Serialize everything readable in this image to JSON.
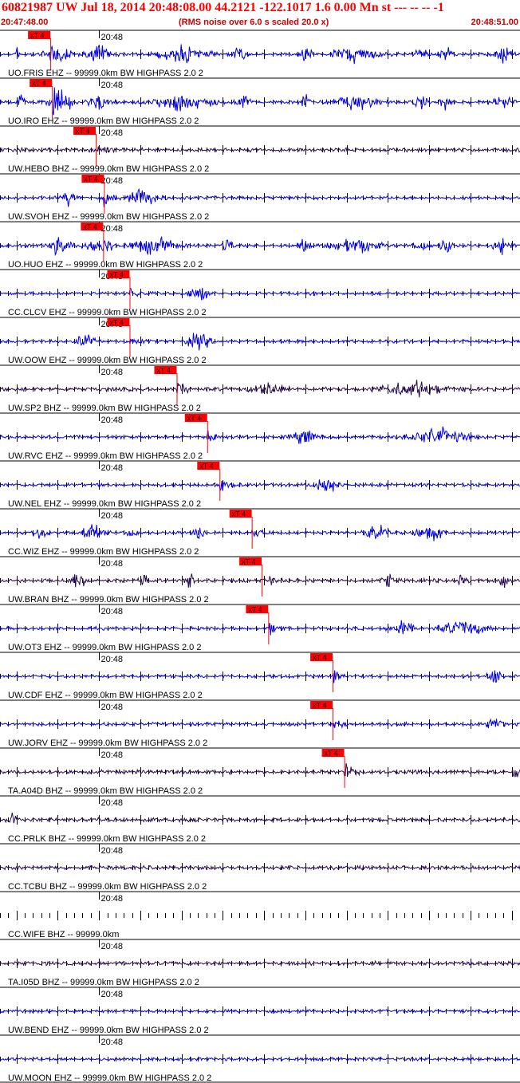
{
  "header": {
    "title": "60821987 UW Jul 18, 2014 20:48:08.00   44.2121 -122.1017  1.6 0.00 Mn st --- -- --  -1",
    "start_time": "20:47:48.00",
    "subtitle": "(RMS noise over 6.0 s scaled 20.0 x)",
    "end_time": "20:48:51.00"
  },
  "colors": {
    "title": "#ff0000",
    "trace_blue": "#0000ee",
    "trace_dark": "#2a0a55",
    "pick": "#ff0000",
    "axis": "#000000"
  },
  "chart_data": {
    "type": "line",
    "title": "60821987 UW Jul 18, 2014 20:48:08.00   44.2121 -122.1017  1.6 0.00 Mn st --- -- --  -1",
    "x_range": [
      "20:47:48.00",
      "20:48:51.00"
    ],
    "x_range_seconds": [
      0,
      63
    ],
    "minute_mark_label": "20:48",
    "minute_mark_seconds": 12,
    "pick_label": "xT 4",
    "traces": [
      {
        "label": "UO.FRIS EHZ -- 99999.0km BW  HIGHPASS  2.0  2",
        "color": "blue",
        "pick_s": 6.1,
        "bursts": [
          [
            2.2,
            0.4
          ],
          [
            6.8,
            1.5
          ],
          [
            12,
            1.3
          ],
          [
            22,
            2.5
          ],
          [
            29,
            0.6
          ],
          [
            37,
            0.6
          ],
          [
            43,
            2.5
          ],
          [
            51,
            0.6
          ],
          [
            54,
            0.7
          ],
          [
            61,
            1.0
          ]
        ]
      },
      {
        "label": "UO.IRO EHZ -- 99999.0km BW  HIGHPASS  2.0  2",
        "color": "blue",
        "pick_s": 6.3,
        "bursts": [
          [
            2.5,
            0.5
          ],
          [
            7.3,
            1.5
          ],
          [
            12,
            1.3
          ],
          [
            22,
            3.2
          ],
          [
            29.5,
            0.8
          ],
          [
            37,
            0.6
          ],
          [
            43,
            2.5
          ],
          [
            51,
            0.6
          ],
          [
            54,
            0.7
          ],
          [
            61,
            1.0
          ]
        ]
      },
      {
        "label": "UW.HEBO BHZ -- 99999.0km BW  HIGHPASS  2.0  2",
        "color": "dark",
        "pick_s": 11.6,
        "bursts": []
      },
      {
        "label": "UW.SVOH EHZ -- 99999.0km BW  HIGHPASS  2.0  2",
        "color": "blue",
        "pick_s": 12.6,
        "bursts": [
          [
            8.5,
            0.8
          ],
          [
            17.5,
            1.8
          ]
        ]
      },
      {
        "label": "UO.HUO EHZ -- 99999.0km BW  HIGHPASS  2.0  2",
        "color": "blue",
        "pick_s": 12.5,
        "bursts": [
          [
            7.2,
            1.3
          ],
          [
            11.8,
            1.3
          ],
          [
            18.5,
            2.5
          ],
          [
            27.5,
            0.6
          ],
          [
            37,
            0.6
          ],
          [
            43,
            2.5
          ],
          [
            51,
            0.6
          ],
          [
            54,
            0.7
          ],
          [
            61,
            1.0
          ]
        ]
      },
      {
        "label": "CC.CLCV EHZ -- 99999.0km BW  HIGHPASS  2.0  2",
        "color": "blue",
        "pick_s": 15.7,
        "bursts": [
          [
            24,
            1.0
          ]
        ]
      },
      {
        "label": "UW.OOW EHZ -- 99999.0km BW  HIGHPASS  2.0  2",
        "color": "blue",
        "pick_s": 15.7,
        "bursts": [
          [
            10.5,
            1.0
          ],
          [
            24.1,
            1.2
          ]
        ]
      },
      {
        "label": "UW.SP2 BHZ -- 99999.0km BW  HIGHPASS  2.0  2",
        "color": "dark",
        "pick_s": 21.4,
        "bursts": [
          [
            32.5,
            1.6
          ],
          [
            50,
            3.5
          ]
        ]
      },
      {
        "label": "UW.RVC EHZ -- 99999.0km BW  HIGHPASS  2.0  2",
        "color": "blue",
        "pick_s": 25.1,
        "bursts": [
          [
            37,
            1.2
          ],
          [
            53,
            3.0
          ]
        ]
      },
      {
        "label": "UW.NEL EHZ -- 99999.0km BW  HIGHPASS  2.0  2",
        "color": "blue",
        "pick_s": 26.6,
        "bursts": [
          [
            39.5,
            1.3
          ]
        ]
      },
      {
        "label": "CC.WIZ EHZ -- 99999.0km BW  HIGHPASS  2.0  2",
        "color": "blue",
        "pick_s": 30.5,
        "bursts": [
          [
            5,
            0.8
          ],
          [
            11,
            1.2
          ],
          [
            16,
            0.5
          ],
          [
            24,
            0.5
          ],
          [
            45.5,
            1.2
          ],
          [
            52,
            1.5
          ]
        ]
      },
      {
        "label": "UW.BRAN BHZ -- 99999.0km BW  HIGHPASS  2.0  2",
        "color": "dark",
        "pick_s": 31.7,
        "bursts": [
          [
            9.5,
            1.0
          ],
          [
            17.5,
            0.4
          ],
          [
            23,
            0.4
          ],
          [
            47,
            0.5
          ],
          [
            56,
            0.5
          ],
          [
            61,
            0.4
          ]
        ]
      },
      {
        "label": "UW.OT3 EHZ -- 99999.0km BW  HIGHPASS  2.0  2",
        "color": "blue",
        "pick_s": 32.5,
        "bursts": [
          [
            48.5,
            1.3
          ],
          [
            56,
            2.5
          ]
        ]
      },
      {
        "label": "UW.CDF EHZ -- 99999.0km BW  HIGHPASS  2.0  2",
        "color": "blue",
        "pick_s": 40.3,
        "bursts": [
          [
            60,
            0.8
          ]
        ]
      },
      {
        "label": "UW.JORV EHZ -- 99999.0km BW  HIGHPASS  2.0  2",
        "color": "blue",
        "pick_s": 40.3,
        "bursts": [
          [
            60,
            0.8
          ]
        ]
      },
      {
        "label": "TA.A04D BHZ -- 99999.0km BW  HIGHPASS  2.0  2",
        "color": "dark",
        "pick_s": 41.7,
        "bursts": [
          [
            62.5,
            0.5
          ]
        ]
      },
      {
        "label": "CC.PRLK BHZ -- 99999.0km BW  HIGHPASS  2.0  2",
        "color": "dark",
        "pick_s": null,
        "bursts": [
          [
            1.5,
            0.6
          ]
        ]
      },
      {
        "label": "CC.TCBU BHZ -- 99999.0km BW  HIGHPASS  2.0  2",
        "color": "dark",
        "pick_s": null,
        "bursts": []
      },
      {
        "label": "CC.WIFE BHZ -- 99999.0km",
        "color": "none",
        "pick_s": null,
        "bursts": []
      },
      {
        "label": "TA.I05D BHZ -- 99999.0km BW  HIGHPASS  2.0  2",
        "color": "dark",
        "pick_s": null,
        "bursts": []
      },
      {
        "label": "UW.BEND EHZ -- 99999.0km BW  HIGHPASS  2.0  2",
        "color": "blue",
        "pick_s": null,
        "bursts": []
      },
      {
        "label": "UW.MOON EHZ -- 99999.0km BW  HIGHPASS  2.0  2",
        "color": "blue",
        "pick_s": null,
        "bursts": []
      }
    ]
  }
}
